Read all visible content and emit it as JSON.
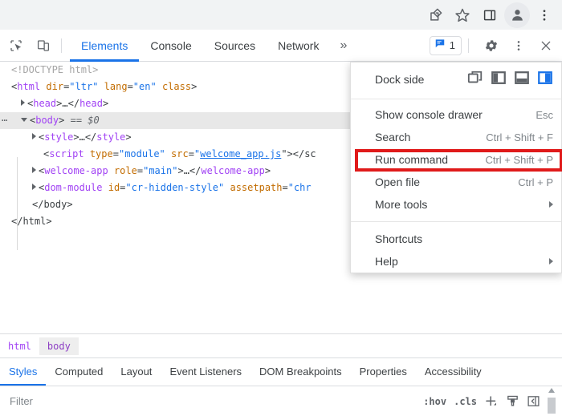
{
  "browser_chrome": {
    "icons": [
      {
        "name": "share-icon",
        "label": "Share"
      },
      {
        "name": "bookmark-star-icon",
        "label": "Bookmark this tab"
      },
      {
        "name": "side-panel-icon",
        "label": "Side panel"
      },
      {
        "name": "profile-avatar-icon",
        "label": "Profile"
      },
      {
        "name": "chrome-menu-icon",
        "label": "Customize and control Google Chrome"
      }
    ]
  },
  "devtools_toolbar": {
    "inspect_label": "Inspect element",
    "device_toolbar_label": "Toggle device toolbar",
    "tabs": [
      {
        "label": "Elements",
        "active": true
      },
      {
        "label": "Console",
        "active": false
      },
      {
        "label": "Sources",
        "active": false
      },
      {
        "label": "Network",
        "active": false
      }
    ],
    "more_tabs_label": "»",
    "issues_count": "1",
    "issues_icon": "issues-chip-icon",
    "settings_label": "Settings",
    "customize_label": "Customize and control DevTools",
    "close_label": "Close DevTools"
  },
  "dom_tree": {
    "lines": [
      {
        "kind": "doctype",
        "text": "<!DOCTYPE html>"
      },
      {
        "kind": "html_open",
        "tag": "html",
        "attrs": "dir=\"ltr\" lang=\"en\" class"
      },
      {
        "kind": "collapsed",
        "text": "<head>…</head>"
      },
      {
        "kind": "selected",
        "text": "<body> == $0"
      },
      {
        "kind": "collapsed",
        "text": "<style>…</style>"
      },
      {
        "kind": "script",
        "text": "<script type=\"module\" src=\"welcome_app.js\"></sc"
      },
      {
        "kind": "collapsed",
        "text": "<welcome-app role=\"main\">…</welcome-app>"
      },
      {
        "kind": "collapsed",
        "text": "<dom-module id=\"cr-hidden-style\" assetpath=\"chr"
      },
      {
        "kind": "close",
        "text": "</body>"
      },
      {
        "kind": "close",
        "text": "</html>"
      }
    ],
    "doctype": "<!DOCTYPE html>",
    "html_tag": "html",
    "html_attr_dir_name": "dir",
    "html_attr_dir_value": "\"ltr\"",
    "html_attr_lang_name": "lang",
    "html_attr_lang_value": "\"en\"",
    "html_attr_class_name": "class",
    "head_text": "head",
    "body_text": "body",
    "body_marker": "== $0",
    "style_text": "style",
    "script_tag": "script",
    "script_attr_type_name": "type",
    "script_attr_type_value": "\"module\"",
    "script_attr_src_name": "src",
    "script_attr_src_value": "welcome_app.js",
    "script_tail": "\"></sc",
    "welcome_tag": "welcome-app",
    "welcome_attr_name": "role",
    "welcome_attr_value": "\"main\"",
    "welcome_ellipsis": "…",
    "dom_module_tag": "dom-module",
    "dom_module_attr_id_name": "id",
    "dom_module_attr_id_value": "\"cr-hidden-style\"",
    "dom_module_attr_assetpath_name": "assetpath",
    "dom_module_attr_assetpath_value": "\"chr",
    "close_body": "</body>",
    "close_html": "</html>",
    "ellipsis": "…"
  },
  "settings_menu": {
    "dock_side": {
      "label": "Dock side",
      "options": [
        {
          "name": "undock-into-separate-window-icon",
          "selected": false
        },
        {
          "name": "dock-to-left-icon",
          "selected": false
        },
        {
          "name": "dock-to-bottom-icon",
          "selected": false
        },
        {
          "name": "dock-to-right-icon",
          "selected": true
        }
      ],
      "selected_color": "#1a73e8"
    },
    "items": [
      {
        "label": "Show console drawer",
        "shortcut": "Esc",
        "submenu": false,
        "highlighted": false
      },
      {
        "label": "Search",
        "shortcut": "Ctrl + Shift + F",
        "submenu": false,
        "highlighted": false
      },
      {
        "label": "Run command",
        "shortcut": "Ctrl + Shift + P",
        "submenu": false,
        "highlighted": true
      },
      {
        "label": "Open file",
        "shortcut": "Ctrl + P",
        "submenu": false,
        "highlighted": false
      },
      {
        "label": "More tools",
        "shortcut": "",
        "submenu": true,
        "highlighted": false
      },
      {
        "label": "Shortcuts",
        "shortcut": "",
        "submenu": false,
        "highlighted": false
      },
      {
        "label": "Help",
        "shortcut": "",
        "submenu": true,
        "highlighted": false
      }
    ],
    "highlight_color": "#e01a1a"
  },
  "breadcrumb": {
    "items": [
      {
        "label": "html",
        "active": false
      },
      {
        "label": "body",
        "active": true
      }
    ]
  },
  "sidebar_tabs": [
    {
      "label": "Styles",
      "active": true
    },
    {
      "label": "Computed",
      "active": false
    },
    {
      "label": "Layout",
      "active": false
    },
    {
      "label": "Event Listeners",
      "active": false
    },
    {
      "label": "DOM Breakpoints",
      "active": false
    },
    {
      "label": "Properties",
      "active": false
    },
    {
      "label": "Accessibility",
      "active": false
    }
  ],
  "filter_bar": {
    "placeholder": "Filter",
    "value": "",
    "hov_label": ":hov",
    "cls_label": ".cls",
    "new_style_rule_label": "+",
    "new_style_rule_icon": "plus-icon",
    "computed_sidebar_icon": "paintbrush-icon",
    "toggle_sidebar_icon": "toggle-sidebar-icon"
  },
  "colors": {
    "accent_blue": "#1a73e8",
    "highlight_red": "#e01a1a",
    "tag_purple": "#a142f4",
    "attr_orange": "#c26c00",
    "chrome_bg": "#f1f3f4"
  }
}
